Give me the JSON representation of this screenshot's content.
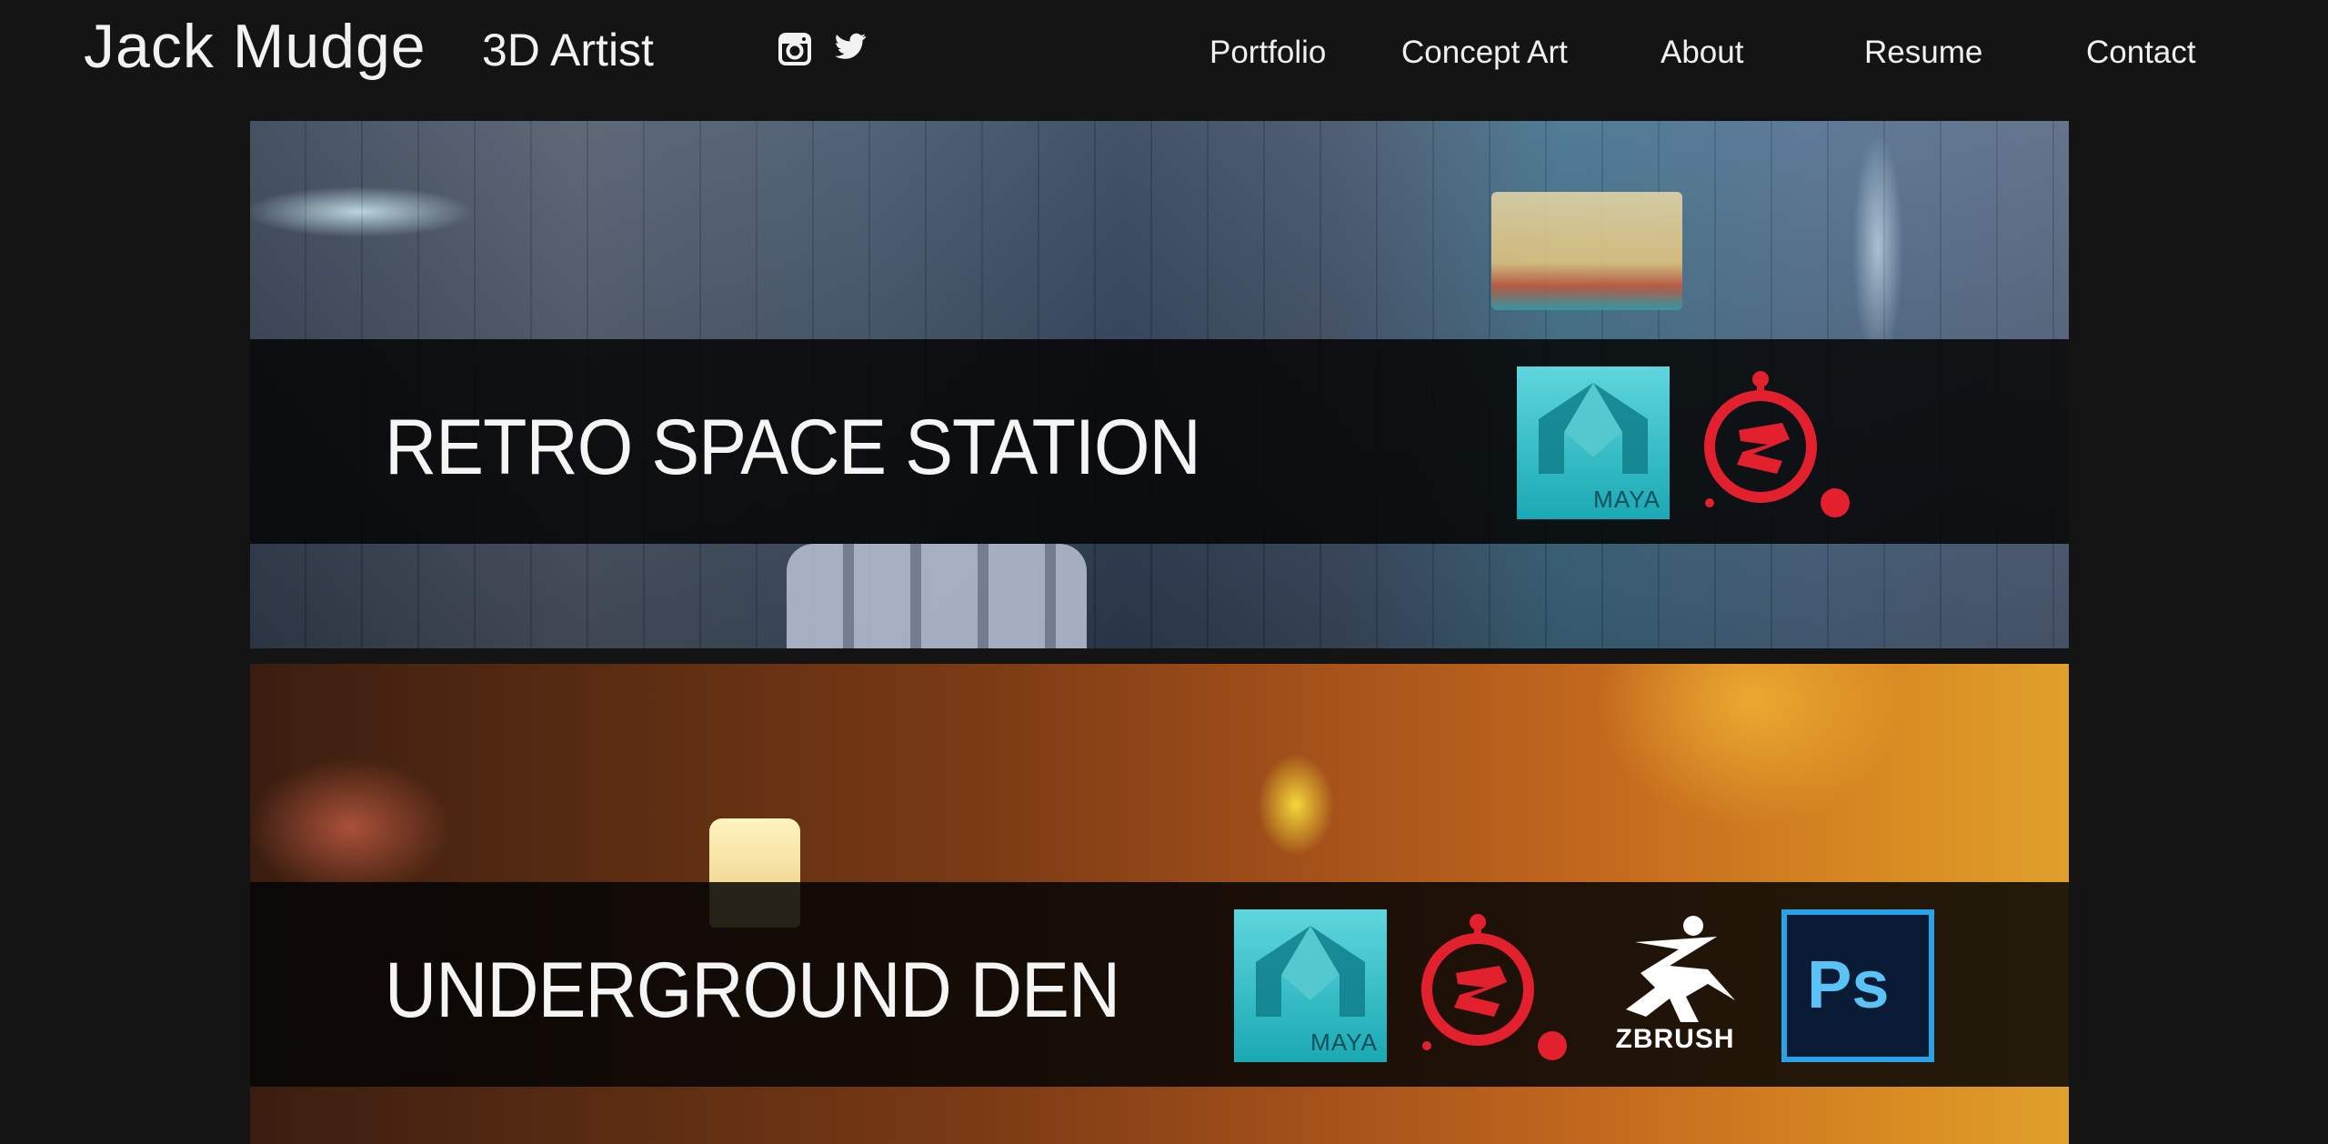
{
  "header": {
    "site_name": "Jack Mudge",
    "tagline": "3D Artist",
    "social": [
      {
        "icon": "instagram-icon"
      },
      {
        "icon": "twitter-icon"
      }
    ]
  },
  "nav": {
    "items": [
      {
        "label": "Portfolio"
      },
      {
        "label": "Concept Art"
      },
      {
        "label": "About"
      },
      {
        "label": "Resume"
      },
      {
        "label": "Contact"
      }
    ]
  },
  "projects": [
    {
      "title": "RETRO SPACE STATION",
      "tools": [
        {
          "icon": "maya-logo",
          "label": "MAYA"
        },
        {
          "icon": "substance-painter-logo"
        }
      ]
    },
    {
      "title": "UNDERGROUND DEN",
      "tools": [
        {
          "icon": "maya-logo",
          "label": "MAYA"
        },
        {
          "icon": "substance-painter-logo"
        },
        {
          "icon": "zbrush-logo",
          "label": "ZBRUSH"
        },
        {
          "icon": "photoshop-logo",
          "label": "Ps"
        }
      ]
    }
  ],
  "colors": {
    "background": "#141414",
    "text": "#ffffff",
    "maya": "#2bbcc6",
    "substance": "#e3202e",
    "photoshop_border": "#2aa3e6",
    "photoshop_text": "#5bc2f5"
  }
}
